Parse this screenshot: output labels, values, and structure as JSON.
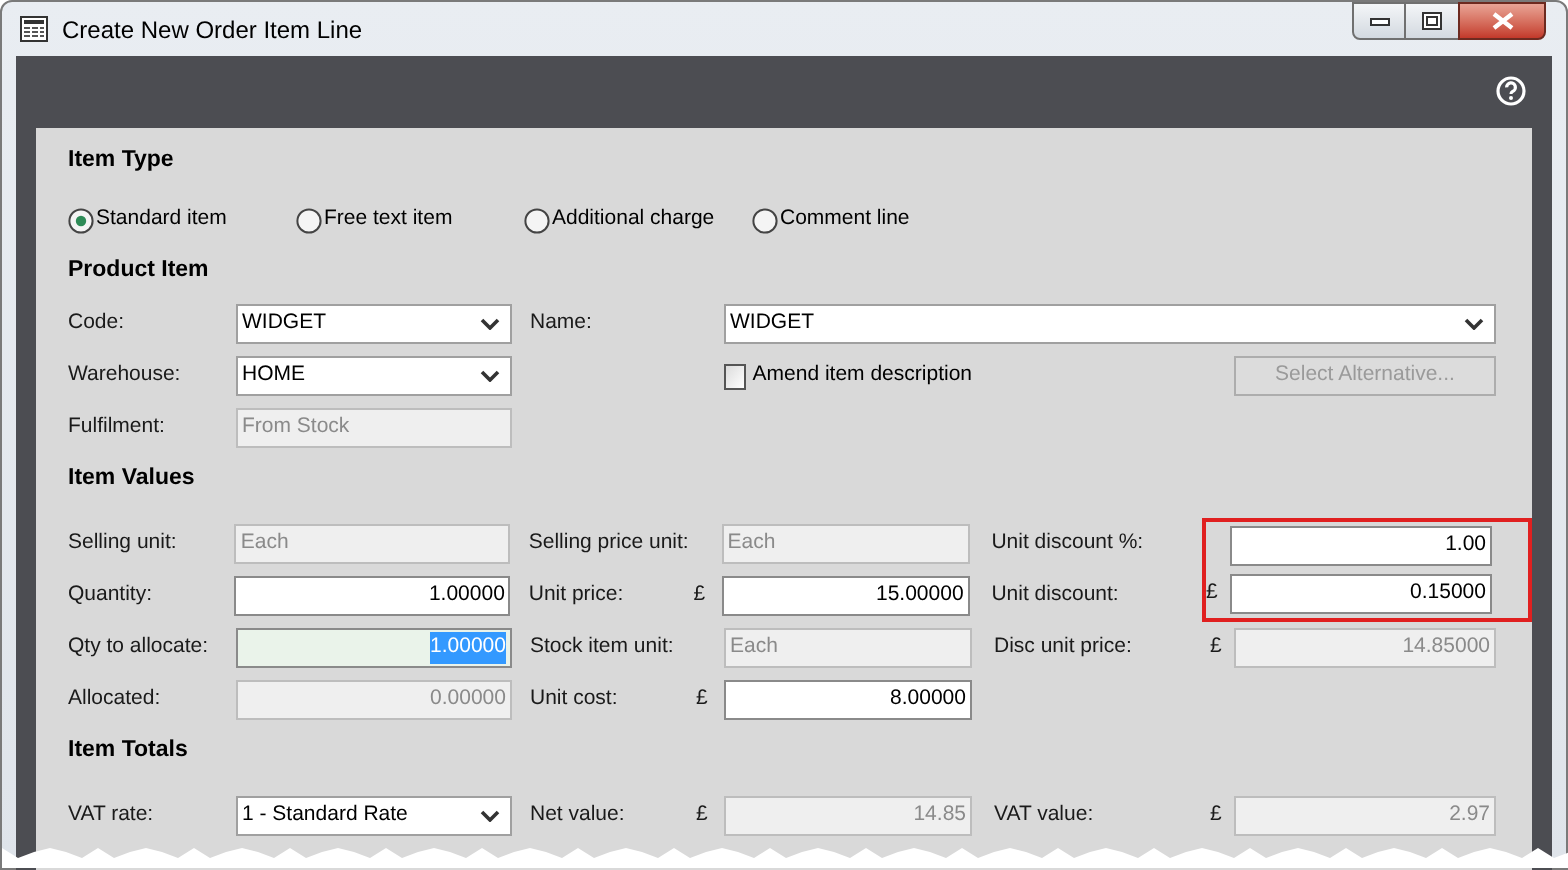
{
  "window": {
    "title": "Create New Order Item Line"
  },
  "sections": [
    {
      "title": "Item Type",
      "radios": [
        {
          "label": "Standard item",
          "selected": true
        },
        {
          "label": "Free text item",
          "selected": false
        },
        {
          "label": "Additional charge",
          "selected": false
        },
        {
          "label": "Comment line",
          "selected": false
        }
      ]
    },
    {
      "title": "Product Item",
      "rows": [
        {
          "left": {
            "label": "Code:",
            "field": {
              "kind": "select",
              "value": "WIDGET"
            }
          },
          "middle": {
            "label": "Name:",
            "field": {
              "kind": "select",
              "value": "WIDGET",
              "wide": true
            }
          }
        },
        {
          "left": {
            "label": "Warehouse:",
            "field": {
              "kind": "select",
              "value": "HOME"
            }
          },
          "middle": {
            "field": {
              "kind": "checkbox",
              "label": "Amend item description",
              "checked": false
            }
          },
          "right": {
            "field": {
              "kind": "button",
              "label": "Select Alternative...",
              "disabled": true
            }
          }
        },
        {
          "left": {
            "label": "Fulfilment:",
            "field": {
              "kind": "readonly",
              "value": "From Stock"
            }
          }
        }
      ]
    },
    {
      "title": "Item Values",
      "rows": [
        {
          "left": {
            "label": "Selling unit:",
            "field": {
              "kind": "readonly",
              "value": "Each"
            }
          },
          "middle": {
            "label": "Selling price unit:",
            "field": {
              "kind": "readonly",
              "value": "Each"
            }
          },
          "right": {
            "label": "Unit discount %:",
            "highlighted": true,
            "field": {
              "kind": "input",
              "value": "1.00",
              "numeric": true
            }
          }
        },
        {
          "left": {
            "label": "Quantity:",
            "field": {
              "kind": "input",
              "value": "1.00000",
              "numeric": true
            }
          },
          "middle": {
            "label": "Unit price:",
            "currency": "£",
            "field": {
              "kind": "input",
              "value": "15.00000",
              "numeric": true
            }
          },
          "right": {
            "label": "Unit discount:",
            "currency": "£",
            "highlighted": true,
            "field": {
              "kind": "input",
              "value": "0.15000",
              "numeric": true
            }
          }
        },
        {
          "left": {
            "label": "Qty to allocate:",
            "field": {
              "kind": "input",
              "value": "1.00000",
              "numeric": true,
              "focused": true
            }
          },
          "middle": {
            "label": "Stock item unit:",
            "field": {
              "kind": "readonly",
              "value": "Each"
            }
          },
          "right": {
            "label": "Disc unit price:",
            "currency": "£",
            "field": {
              "kind": "readonly",
              "value": "14.85000",
              "numeric": true
            }
          }
        },
        {
          "left": {
            "label": "Allocated:",
            "field": {
              "kind": "readonly",
              "value": "0.00000",
              "numeric": true
            }
          },
          "middle": {
            "label": "Unit cost:",
            "currency": "£",
            "field": {
              "kind": "input",
              "value": "8.00000",
              "numeric": true
            }
          }
        }
      ]
    },
    {
      "title": "Item Totals",
      "rows": [
        {
          "left": {
            "label": "VAT rate:",
            "field": {
              "kind": "select",
              "value": "1 - Standard Rate"
            }
          },
          "middle": {
            "label": "Net value:",
            "currency": "£",
            "field": {
              "kind": "readonly",
              "value": "14.85",
              "numeric": true
            }
          },
          "right": {
            "label": "VAT value:",
            "currency": "£",
            "field": {
              "kind": "readonly",
              "value": "2.97",
              "numeric": true
            }
          }
        }
      ]
    }
  ]
}
